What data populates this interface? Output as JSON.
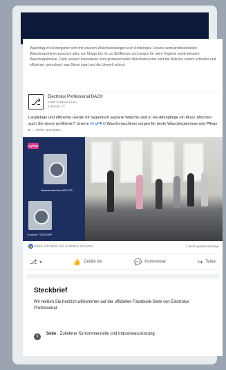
{
  "snippet": {
    "text": "Waschtag im Kindergarten wird mit unseren Wäscheleistungen zum Kinderspiel. Unsere semi-professionellen Waschmaschinen waschen alles von Mopps bis hin zu Stoffkissen und sorgen für mehr Hygiene sowie bessere Waschergebnisse. Dank unserer innovativen semi-professionellen Wäschetrockner wird die Wäsche zudem schneller und effizienter getrocknet, was Strom spart und die Umwelt schont."
  },
  "page": {
    "name": "Electrolux Professional DACH",
    "followers": "1.252 Follower:innen",
    "meta": "1 Woche • ©"
  },
  "post": {
    "text_main": "Langlebige und effiziente Geräte für hygienisch saubere Wäsche sind in der Altenpflege ein Muss. Möchten auch Sie davon profitieren? Unsere ",
    "hashtag": "#myPRO",
    "text_tail": " Waschmaschinen sorgen für beste Waschergebnisse und Pflege c",
    "more": "... mehr anzeigen"
  },
  "media": {
    "badge": "myPRO",
    "washer_label": "Waschmaschine WE170P",
    "dryer_label": "Trockner TE1220HP"
  },
  "reactions": {
    "people": "Meike Schultheiß und 18 weitere Personen",
    "shares": "2 direkt geteilte Beiträge"
  },
  "actions": {
    "like": "Gefällt mir",
    "comment": "Kommentar",
    "share": "Teilen"
  },
  "about": {
    "title": "Steckbrief",
    "description": "Wir heißen Sie herzlich willkommen auf der offiziellen Facebook-Seite von Electrolux Professional.",
    "row_label": "Seite",
    "row_text": " · Zulieferer für kommerzielle und Industrieausrüstung"
  },
  "colors": {
    "header": "#0b1a3a",
    "accent": "#1e5cbf",
    "media_panel": "#1c2f5f"
  }
}
